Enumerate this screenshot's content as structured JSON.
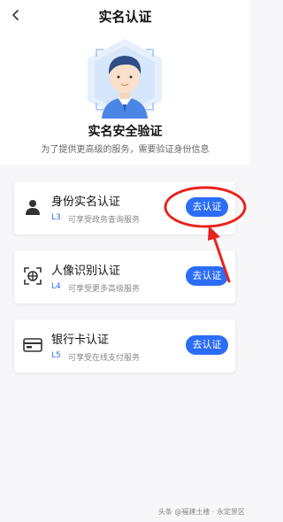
{
  "nav": {
    "title": "实名认证",
    "back_icon": "chevron-left-icon"
  },
  "hero": {
    "illustration_icon": "user-avatar-icon",
    "title": "实名安全验证",
    "subtitle": "为了提供更高级的服务，需要验证身份信息"
  },
  "cards": [
    {
      "icon": "person-icon",
      "title": "身份实名认证",
      "level": "L3",
      "desc": "可享受政务查询服务",
      "button": "去认证"
    },
    {
      "icon": "face-scan-icon",
      "title": "人像识别认证",
      "level": "L4",
      "desc": "可享受更多高级服务",
      "button": "去认证"
    },
    {
      "icon": "bank-card-icon",
      "title": "银行卡认证",
      "level": "L5",
      "desc": "可享受在线支付服务",
      "button": "去认证"
    }
  ],
  "watermark": "头条 @福建土楼 · 永定景区",
  "colors": {
    "accent": "#2b6df6",
    "annotation": "#e8231f"
  }
}
